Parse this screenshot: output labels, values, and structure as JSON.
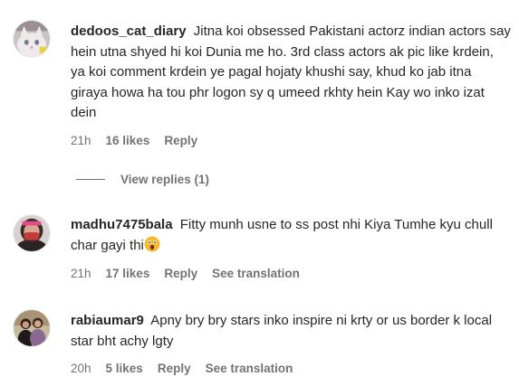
{
  "comments": [
    {
      "username": "dedoos_cat_diary",
      "text": "Jitna koi obsessed Pakistani actorz indian actors say hein utna shyed hi koi Dunia me ho. 3rd class actors ak pic like krdein, ya koi comment krdein ye pagal hojaty khushi say, khud ko jab itna giraya howa ha tou phr logon sy q umeed rkhty hein Kay wo inko izat dein",
      "time": "21h",
      "likes": "16 likes",
      "reply": "Reply",
      "avatar_icon": "white-cat-avatar"
    },
    {
      "username": "madhu7475bala",
      "text": "Fitty munh usne to ss post nhi Kiya Tumhe kyu chull char gayi thi",
      "emoji": "astonished-face-emoji",
      "time": "21h",
      "likes": "17 likes",
      "reply": "Reply",
      "translate": "See translation",
      "avatar_icon": "woman-with-mask-avatar"
    },
    {
      "username": "rabiaumar9",
      "text": "Apny bry bry stars inko inspire ni krty or us border k local star bht achy lgty",
      "time": "20h",
      "likes": "5 likes",
      "reply": "Reply",
      "translate": "See translation",
      "avatar_icon": "two-people-avatar"
    }
  ],
  "view_replies": "View replies (1)"
}
